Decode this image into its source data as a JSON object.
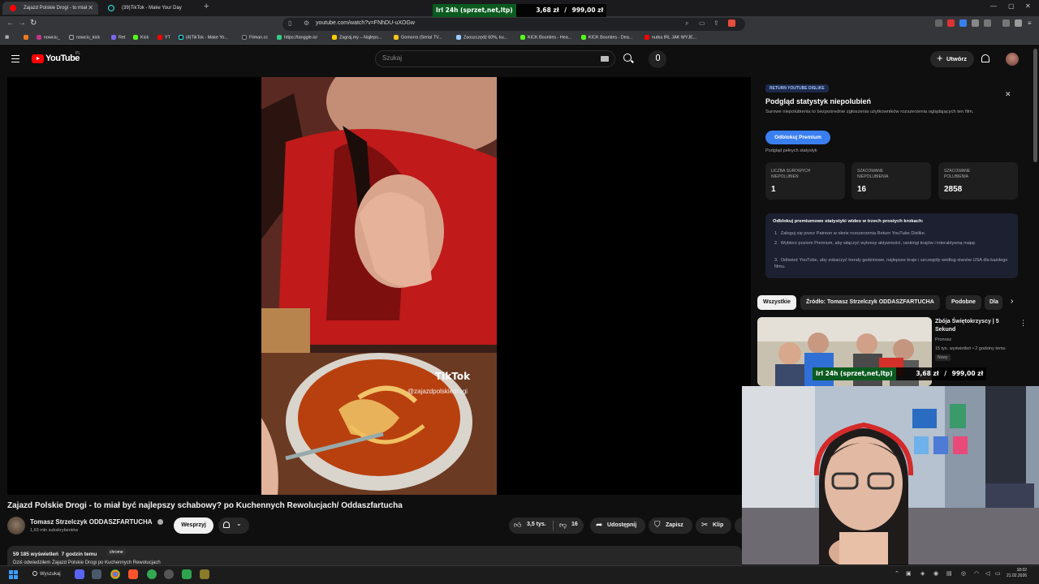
{
  "browser": {
    "tabs": [
      {
        "label": "Zajazd Polskie Drogi - to miał",
        "active": true
      },
      {
        "label": "(39)TikTok - Make Your Day",
        "active": false
      }
    ],
    "url": "youtube.com/watch?v=FNhDU-uXOGw",
    "bookmarks": [
      "nowciu_",
      "nowciu_kick",
      "Ret",
      "Kick",
      "YT",
      "(4)TikTok - Make Yo...",
      "Filman.cc",
      "https://tanggle.io/",
      "Zagraj.my – Najleps...",
      "Gomorra (Serial TV...",
      "Zaoszczędź 60%, ku...",
      "KICK Bounties - Hea...",
      "KICK Bounties - Dea...",
      "nutka IRL JAK WYJE..."
    ]
  },
  "stream_overlay": {
    "left_label": "Irl 24h (sprzet,net,ltp)",
    "amount": "3,68 zł",
    "goal": "999,00 zł"
  },
  "youtube": {
    "logo": "YouTube",
    "logo_region": "PL",
    "search_placeholder": "Szukaj",
    "create_label": "Utwórz",
    "video": {
      "title": "Zajazd Polskie Drogi - to miał być najlepszy schabowy? po Kuchennych Rewolucjach/ Oddaszfartucha",
      "channel": "Tomasz Strzelczyk ODDASZFARTUCHA",
      "subscribers": "1,63 mln subskrybentów",
      "support_label": "Wesprzyj",
      "likes": "3,5 tys.",
      "dislikes": "16",
      "share_label": "Udostępnij",
      "save_label": "Zapisz",
      "clip_label": "Klip",
      "views": "59 185 wyświetleń",
      "time_ago": "7 godzin temu",
      "description_line": "Dziś odwiedziłem Zajazd Polskie Drogi po Kuchennych Rewolucjach",
      "tooltip": "chrome",
      "tiktok_label": "TikTok",
      "tiktok_handle": "@zajazdpolskiedrogi"
    },
    "ryd": {
      "badge": "RETURN YOUTUBE DISLIKE",
      "title": "Podgląd statystyk niepolubień",
      "description": "Surowe niepolubienia to bezpośrednie zgłoszenia użytkowników rozszerzenia oglądających ten film.",
      "unlock_label": "Odblokuj Premium",
      "full_stats": "Podgląd pełnych statystyk",
      "cards": [
        {
          "label": "LICZBA SUROWYCH NIEPOLUBIEŃ",
          "value": "1"
        },
        {
          "label": "SZACOWANE NIEPOLUBIENIA",
          "value": "16"
        },
        {
          "label": "SZACOWANE POLUBIENIA",
          "value": "2858"
        }
      ],
      "steps_title": "Odblokuj premiumowe statystyki wideo w trzech prostych krokach:",
      "steps": [
        "Zaloguj się przez Patreon w oknie rozszerzenia Return YouTube Dislike.",
        "Wybierz poziom Premium, aby włączyć wykresy aktywności, rankingi krajów i interaktywną mapę.",
        "Odśwież YouTube, aby zobaczyć trendy godzinowe, najlepsze kraje i szczegóły według stanów USA dla każdego filmu."
      ]
    },
    "chips": [
      "Wszystkie",
      "Źródło: Tomasz Strzelczyk ODDASZFARTUCHA",
      "Podobne",
      "Dla"
    ],
    "recommended": {
      "title": "Zbója Świętokrzyscy | 5 Sekund",
      "channel": "Pronosz",
      "meta": "15 tys. wyświetleń • 2 godziny temu",
      "badge": "Nowy"
    }
  },
  "taskbar": {
    "search_label": "Wyszukaj",
    "time": "18:02",
    "date": "21.02.2026"
  }
}
